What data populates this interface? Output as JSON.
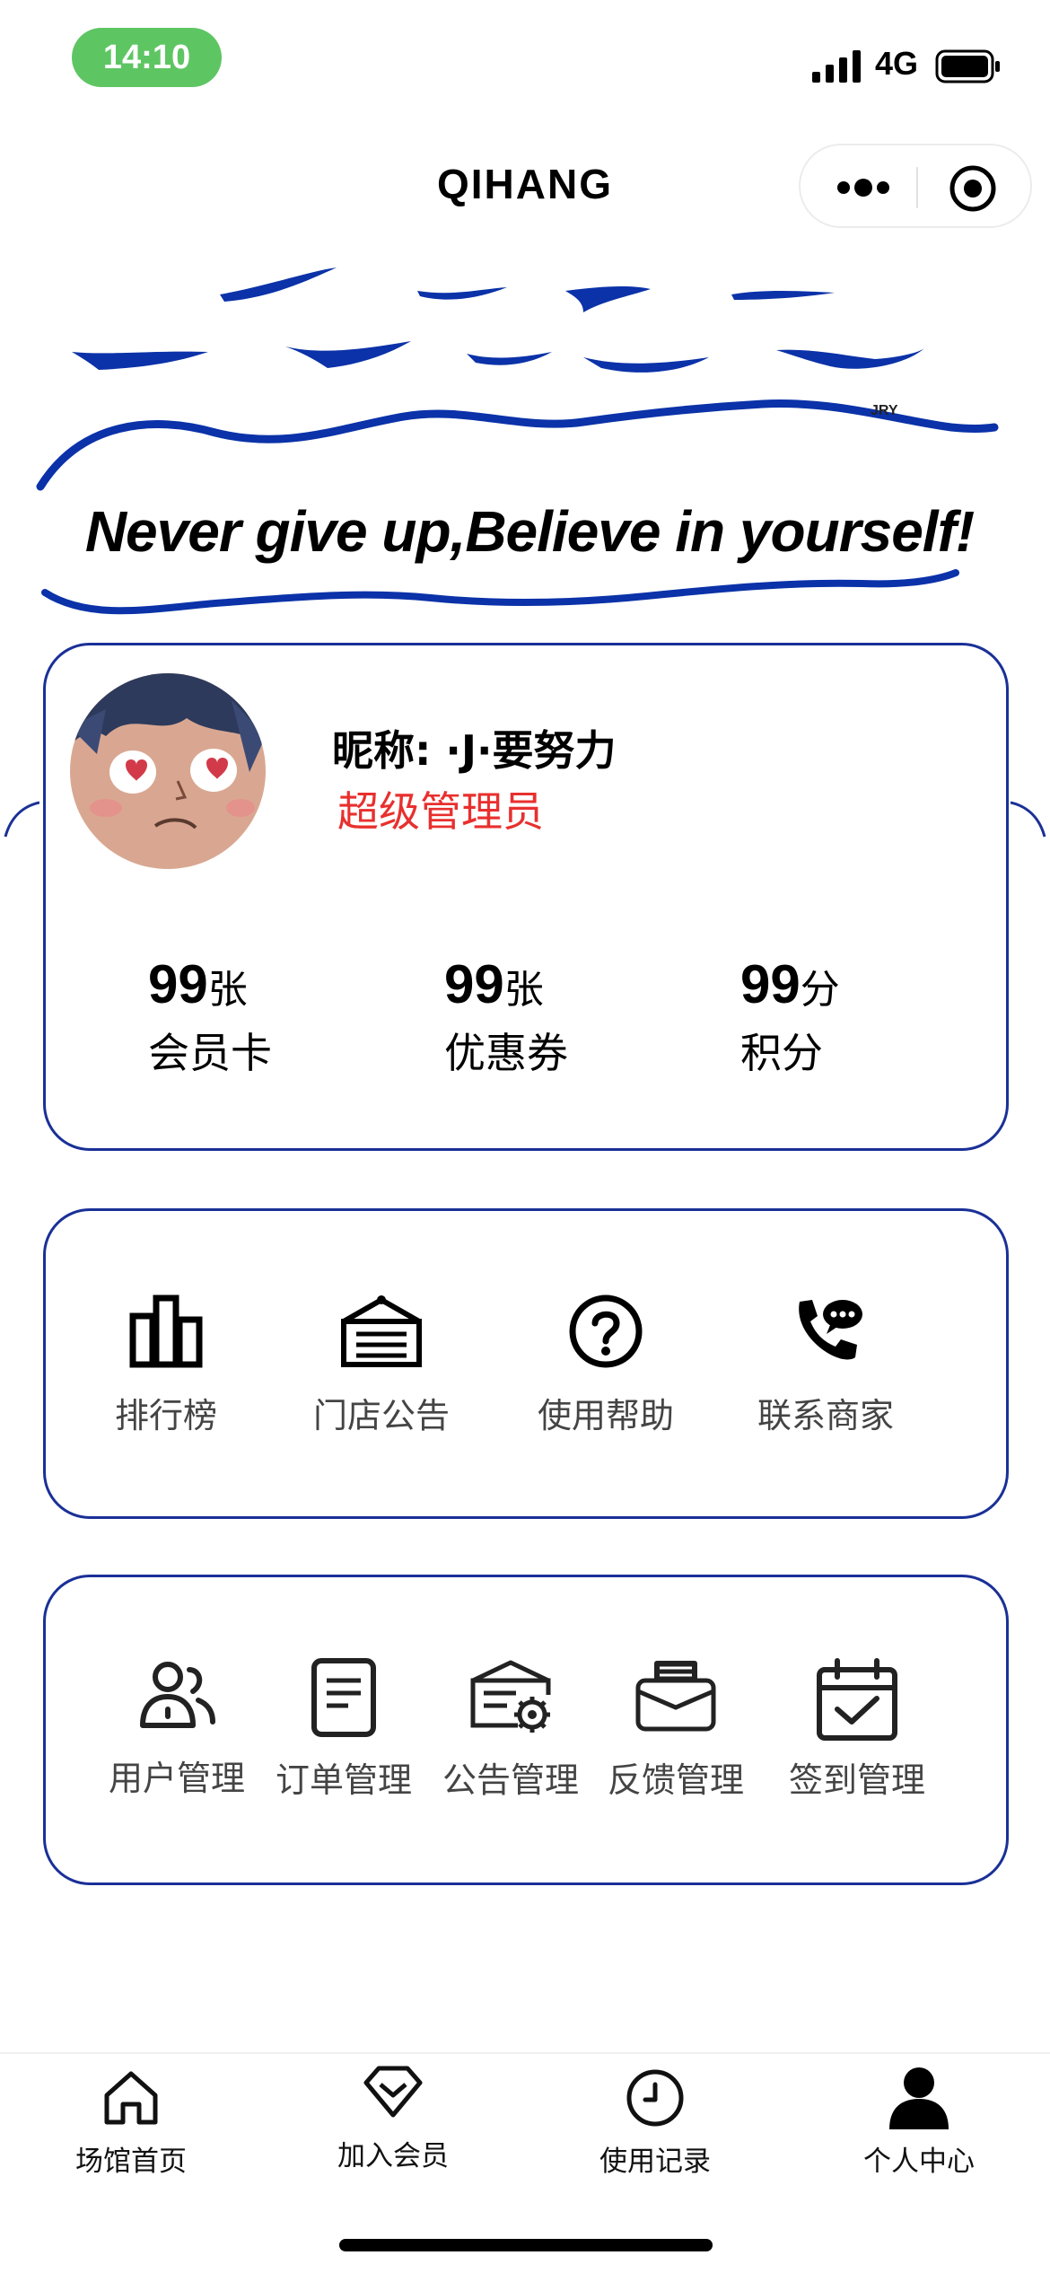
{
  "status_bar": {
    "time": "14:10",
    "network": "4G"
  },
  "nav": {
    "title": "QIHANG"
  },
  "banner": {
    "motto": "Never give up,Believe in yourself!",
    "signature": "JRY"
  },
  "profile": {
    "nickname_label": "昵称:",
    "nickname": "·J·要努力",
    "role": "超级管理员",
    "stats": [
      {
        "value": "99",
        "unit": "张",
        "label": "会员卡"
      },
      {
        "value": "99",
        "unit": "张",
        "label": "优惠券"
      },
      {
        "value": "99",
        "unit": "分",
        "label": "积分"
      }
    ]
  },
  "quick_links": [
    {
      "label": "排行榜",
      "icon": "bar-chart-icon"
    },
    {
      "label": "门店公告",
      "icon": "notice-board-icon"
    },
    {
      "label": "使用帮助",
      "icon": "help-icon"
    },
    {
      "label": "联系商家",
      "icon": "phone-chat-icon"
    }
  ],
  "admin_tools": [
    {
      "label": "用户管理",
      "icon": "users-icon"
    },
    {
      "label": "订单管理",
      "icon": "document-icon"
    },
    {
      "label": "公告管理",
      "icon": "notice-settings-icon"
    },
    {
      "label": "反馈管理",
      "icon": "inbox-icon"
    },
    {
      "label": "签到管理",
      "icon": "calendar-check-icon"
    }
  ],
  "tabbar": [
    {
      "label": "场馆首页",
      "icon": "home-icon"
    },
    {
      "label": "加入会员",
      "icon": "diamond-icon"
    },
    {
      "label": "使用记录",
      "icon": "clock-icon"
    },
    {
      "label": "个人中心",
      "icon": "person-icon"
    }
  ],
  "colors": {
    "card_border": "#1a3097",
    "role_text": "#e8302e",
    "time_pill": "#5ec563",
    "wave": "#0b32a8"
  }
}
